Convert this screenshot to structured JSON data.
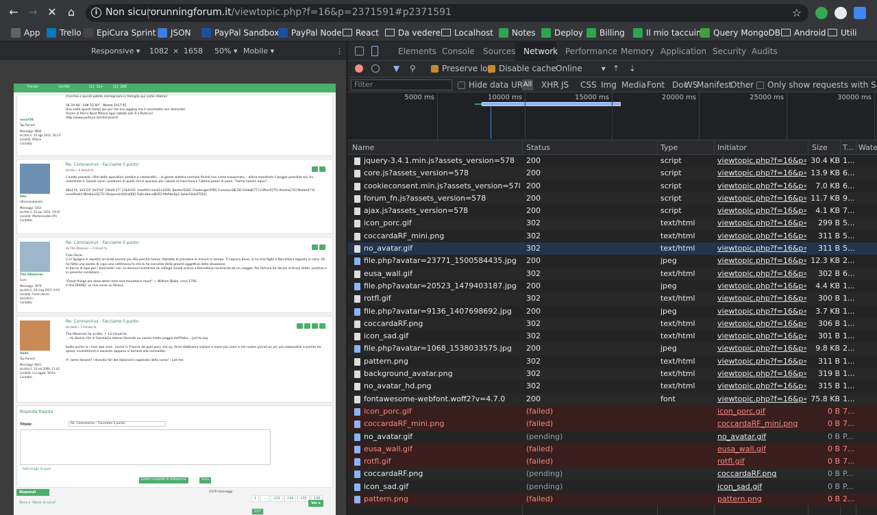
{
  "browser": {
    "not_secure": "Non sicuro",
    "url_host": "runningforum.it",
    "url_path": "/viewtopic.php?f=16&p=2371591#p2371591"
  },
  "bookmarks": [
    {
      "label": "App",
      "color": "#5f6368"
    },
    {
      "label": "Trello",
      "color": "#0079bf"
    },
    {
      "label": "EpiCura Sprint",
      "color": "#444"
    },
    {
      "label": "JSON",
      "color": "#3c7de1"
    },
    {
      "label": "PayPal Sandbox",
      "color": "#1b4fa0"
    },
    {
      "label": "PayPal Node",
      "color": "#1b4fa0"
    },
    {
      "label": "React",
      "color": "folder"
    },
    {
      "label": "Da vedere",
      "color": "folder"
    },
    {
      "label": "Localhost",
      "color": "folder"
    },
    {
      "label": "Notes",
      "color": "#2da44e"
    },
    {
      "label": "Deploy",
      "color": "#2da44e"
    },
    {
      "label": "Billing",
      "color": "#2da44e"
    },
    {
      "label": "Il mio taccuino",
      "color": "#2da44e"
    },
    {
      "label": "Query MongoDB",
      "color": "#3fa037"
    },
    {
      "label": "Android",
      "color": "folder"
    },
    {
      "label": "Utili",
      "color": "folder"
    }
  ],
  "device_toolbar": {
    "device": "Responsive",
    "width": "1082",
    "x": "×",
    "height": "1658",
    "zoom": "50%",
    "mode": "Mobile"
  },
  "devtools_tabs": [
    "Elements",
    "Console",
    "Sources",
    "Network",
    "Performance",
    "Memory",
    "Application",
    "Security",
    "Audits"
  ],
  "network_toolbar": {
    "preserve_log": "Preserve log",
    "disable_cache": "Disable cache",
    "throttle": "Online"
  },
  "filter_bar": {
    "placeholder": "Filter",
    "hide_data_urls": "Hide data URLs",
    "all": "All",
    "types": [
      "XHR",
      "JS",
      "CSS",
      "Img",
      "Media",
      "Font",
      "Doc",
      "WS",
      "Manifest",
      "Other"
    ],
    "samesite": "Only show requests with SameSite"
  },
  "overview_ticks": [
    "5000 ms",
    "10000 ms",
    "15000 ms",
    "20000 ms",
    "25000 ms",
    "30000 ms"
  ],
  "columns": {
    "name": "Name",
    "status": "Status",
    "type": "Type",
    "initiator": "Initiator",
    "size": "Size",
    "time": "T...",
    "waterfall": "Water"
  },
  "rows": [
    {
      "name": "jquery-3.4.1.min.js?assets_version=578",
      "status": "200",
      "type": "script",
      "initiator": "viewtopic.php?f=16&p=2...",
      "size": "30.4 KB",
      "time": "1...",
      "state": "ok",
      "icon": "doc"
    },
    {
      "name": "core.js?assets_version=578",
      "status": "200",
      "type": "script",
      "initiator": "viewtopic.php?f=16&p=2...",
      "size": "13.9 KB",
      "time": "6...",
      "state": "ok",
      "icon": "doc"
    },
    {
      "name": "cookieconsent.min.js?assets_version=578",
      "status": "200",
      "type": "script",
      "initiator": "viewtopic.php?f=16&p=2...",
      "size": "7.0 KB",
      "time": "6...",
      "state": "ok",
      "icon": "doc"
    },
    {
      "name": "forum_fn.js?assets_version=578",
      "status": "200",
      "type": "script",
      "initiator": "viewtopic.php?f=16&p=2...",
      "size": "11.7 KB",
      "time": "9...",
      "state": "ok",
      "icon": "doc"
    },
    {
      "name": "ajax.js?assets_version=578",
      "status": "200",
      "type": "script",
      "initiator": "viewtopic.php?f=16&p=2...",
      "size": "4.1 KB",
      "time": "7...",
      "state": "ok",
      "icon": "doc"
    },
    {
      "name": "icon_porc.gif",
      "status": "302",
      "type": "text/html",
      "initiator": "viewtopic.php?f=16&p=2...",
      "size": "299 B",
      "time": "5...",
      "state": "ok",
      "icon": "doc"
    },
    {
      "name": "coccardaRF_mini.png",
      "status": "302",
      "type": "text/html",
      "initiator": "viewtopic.php?f=16&p=2...",
      "size": "311 B",
      "time": "5...",
      "state": "ok",
      "icon": "doc"
    },
    {
      "name": "no_avatar.gif",
      "status": "302",
      "type": "text/html",
      "initiator": "viewtopic.php?f=16&p=2...",
      "size": "311 B",
      "time": "5...",
      "state": "sel",
      "icon": "doc"
    },
    {
      "name": "file.php?avatar=23771_1500584435.jpg",
      "status": "200",
      "type": "jpeg",
      "initiator": "viewtopic.php?f=16&p=2...",
      "size": "12.3 KB",
      "time": "2...",
      "state": "ok",
      "icon": "img"
    },
    {
      "name": "eusa_wall.gif",
      "status": "302",
      "type": "text/html",
      "initiator": "viewtopic.php?f=16&p=2...",
      "size": "302 B",
      "time": "6...",
      "state": "ok",
      "icon": "doc"
    },
    {
      "name": "file.php?avatar=20523_1479403187.jpg",
      "status": "200",
      "type": "jpeg",
      "initiator": "viewtopic.php?f=16&p=2...",
      "size": "4.4 KB",
      "time": "1...",
      "state": "ok",
      "icon": "img"
    },
    {
      "name": "rotfl.gif",
      "status": "302",
      "type": "text/html",
      "initiator": "viewtopic.php?f=16&p=2...",
      "size": "300 B",
      "time": "1...",
      "state": "ok",
      "icon": "doc"
    },
    {
      "name": "file.php?avatar=9136_1407698692.jpg",
      "status": "200",
      "type": "jpeg",
      "initiator": "viewtopic.php?f=16&p=2...",
      "size": "3.7 KB",
      "time": "1...",
      "state": "ok",
      "icon": "img"
    },
    {
      "name": "coccardaRF.png",
      "status": "302",
      "type": "text/html",
      "initiator": "viewtopic.php?f=16&p=2...",
      "size": "306 B",
      "time": "1...",
      "state": "ok",
      "icon": "doc"
    },
    {
      "name": "icon_sad.gif",
      "status": "302",
      "type": "text/html",
      "initiator": "viewtopic.php?f=16&p=2...",
      "size": "301 B",
      "time": "1...",
      "state": "ok",
      "icon": "doc"
    },
    {
      "name": "file.php?avatar=1068_1538033575.jpg",
      "status": "200",
      "type": "jpeg",
      "initiator": "viewtopic.php?f=16&p=2...",
      "size": "9.8 KB",
      "time": "2...",
      "state": "ok",
      "icon": "img"
    },
    {
      "name": "pattern.png",
      "status": "302",
      "type": "text/html",
      "initiator": "viewtopic.php?f=16&p=2...",
      "size": "311 B",
      "time": "1...",
      "state": "ok",
      "icon": "doc"
    },
    {
      "name": "background_avatar.png",
      "status": "302",
      "type": "text/html",
      "initiator": "viewtopic.php?f=16&p=2...",
      "size": "319 B",
      "time": "1...",
      "state": "ok",
      "icon": "doc"
    },
    {
      "name": "no_avatar_hd.png",
      "status": "302",
      "type": "text/html",
      "initiator": "viewtopic.php?f=16&p=2...",
      "size": "315 B",
      "time": "1...",
      "state": "ok",
      "icon": "doc"
    },
    {
      "name": "fontawesome-webfont.woff2?v=4.7.0",
      "status": "200",
      "type": "font",
      "initiator": "viewtopic.php?f=16&p=2...",
      "size": "75.8 KB",
      "time": "1...",
      "state": "ok",
      "icon": "doc"
    },
    {
      "name": "icon_porc.gif",
      "status": "(failed)",
      "type": "",
      "initiator": "icon_porc.gif",
      "size": "0 B",
      "time": "7...",
      "state": "failed",
      "icon": "img"
    },
    {
      "name": "coccardaRF_mini.png",
      "status": "(failed)",
      "type": "",
      "initiator": "coccardaRF_mini.png",
      "size": "0 B",
      "time": "7...",
      "state": "failed",
      "icon": "img"
    },
    {
      "name": "no_avatar.gif",
      "status": "(pending)",
      "type": "",
      "initiator": "no_avatar.gif",
      "size": "0 B",
      "time": "P...",
      "state": "pending",
      "icon": "img"
    },
    {
      "name": "eusa_wall.gif",
      "status": "(failed)",
      "type": "",
      "initiator": "eusa_wall.gif",
      "size": "0 B",
      "time": "7...",
      "state": "failed",
      "icon": "img"
    },
    {
      "name": "rotfl.gif",
      "status": "(failed)",
      "type": "",
      "initiator": "rotfl.gif",
      "size": "0 B",
      "time": "7...",
      "state": "failed",
      "icon": "img"
    },
    {
      "name": "coccardaRF.png",
      "status": "(pending)",
      "type": "",
      "initiator": "coccardaRF.png",
      "size": "0 B",
      "time": "P...",
      "state": "pending",
      "icon": "img"
    },
    {
      "name": "icon_sad.gif",
      "status": "(pending)",
      "type": "",
      "initiator": "icon_sad.gif",
      "size": "0 B",
      "time": "P...",
      "state": "pending",
      "icon": "img"
    },
    {
      "name": "pattern.png",
      "status": "(failed)",
      "type": "",
      "initiator": "pattern.png",
      "size": "0 B",
      "time": "2...",
      "state": "failed",
      "icon": "img"
    }
  ],
  "forum": {
    "nav": [
      "Forum",
      "Iscritti",
      "(1): 12+",
      "(1): 100"
    ],
    "posts": [
      {
        "title": "",
        "by": "",
        "user": "oscar56",
        "rank": "Top Runner",
        "meta": "Messaggi: 6894\nIscritto il: 20 ago 2012, 16:13\nLocalità: Milano\nContatta:",
        "text": "d'occhio e quindi potete immaginare in famiglia qui come stiamo!\n\n5K 24'48 – 10K 52'40\" - Mezza 1h57'45\nUna volta questi tempi qui per me era jogging ma il vecchietto non demorde!\nAnche al Parco Nord Milano ogni sabato alle 9 il Parkrun!\nhttp://www.parkrun.it/milanonord/"
      },
      {
        "title": "Re: Coronavirus - Facciamo il punto",
        "by": "da fele » 6 minuti fa",
        "user": "fele",
        "rank": "Ultramaratoneta",
        "meta": "Messaggi: 1053\nIscritto il: 25 apr 2016, 19:10\nLocalità: Montescudaio (PI)\nContatta:",
        "text": "L'avete presenti i film delle apocalissi zombie o catastrofici... la gente sembra normale finché non viene esasperata... allora manifesta il peggio possibile e/o chi realmente è. Questi sono i prodromi di quelli che ti sparano per rubarti la macchina o l'ultimo pezzo di pane. \"Homo homini lupus\".\n\n68x174. 1k3'23\" 5k3'54\" 10k49'17\" 21k1h55' maxK43 maxD+2200. Boston5[82] ChallengerATR5 Cumulus18[78] Glide8[77] Clifton5[75] Akasha[74] Mutant[73] LonePeak4 Nimbus22[71] ResponsivUltra[66] Fujitrabuco8[65] MafateSp2 SolarGlide5T[61]."
      },
      {
        "title": "Re: Coronavirus - Facciamo il punto",
        "by": "da The Observer » 3 minuti fa",
        "user": "The Observer",
        "rank": "Guru",
        "meta": "Messaggi: 2979\nIscritto il: 26 mag 2015, 9:05\nLocalità: Forse dovrei deciderm...\nContatta:",
        "text": "Ciao Oscar,\nsì in Spagna si aspetta un'onda ancora più alta perché hanno ritardato di prendere le misure in tempo. Ti capisco bene, io ho mio figlio a Barcellona tappato in casa. Gli ho fatto una lavata di capo una settimana fa che lo ha convinto della gravità oggettiva della situazione.\nIn bocca al lupo per i tuoi/vostri cari. Io doveva incontrare un collega lunedì scorso a Barcellona rientrando da un viaggio. Per fortuna ho deciso di tirare dritto: positivo e in pessime condizioni...\n\n\"Great things are done when men and mountains meet\" — William Blake, circa 1793\nIl mio DIARIO. Le mie corse su Strava"
      },
      {
        "title": "Re: Coronavirus - Facciamo il punto",
        "by": "da dado » 1 minuto fa",
        "user": "dado",
        "rank": "Top Runner",
        "meta": "Messaggi: 6041\nIscritto il: 10 set 2009, 17:43\nLocalità: La Loggia, Torino\nContatta:",
        "text": "The Observer ha scritto: ↑                                                  13 minuti fa\n... mi diceva che in Germania stanno facendo un casino molto peggio dell'Italia... just to say.\n\nbutto anche io i miei due cent.. anche in Francia da quel poco che so, forse dobbiamo iniziare a esser più coesi e nel nostro piccoli un po' più nazionalisti a partire da spese, investimenti e vacanze (appena si tornerà alla normalità).\n\nrf: come donare? / diventa fan del dizionario ragionato della corsa! / just me"
      }
    ],
    "reply": {
      "title": "Risposta Rapida",
      "label": "Titolo:",
      "value": "Re: Coronavirus - Facciamo il punto",
      "add_image": "Add image to post",
      "editor_btn": "Editor completo & Anteprima",
      "send_btn": "Invia",
      "reply_btn": "Rispondi",
      "messages": "2370 messaggi",
      "pages": [
        "1",
        "…",
        "233",
        "234",
        "235",
        "236",
        "237"
      ],
      "back": "Torna a \"Storie di corsa\"",
      "goto": "Vai a"
    }
  }
}
